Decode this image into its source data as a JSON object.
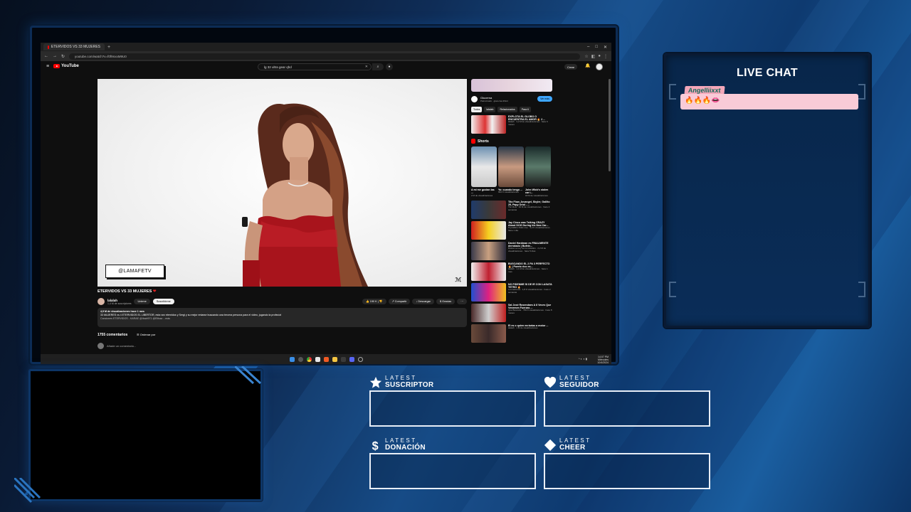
{
  "browser": {
    "tab_title": "ETERVIDOS VS 33 MUJERES",
    "new_tab": "+",
    "url": "youtube.com/watch?v=f0f9nxxM9U0",
    "window_controls": [
      "–",
      "□",
      "✕"
    ]
  },
  "youtube": {
    "logo_text": "YouTube",
    "search_query": "lg 32 ultra gear qhd",
    "create_label": "Crear",
    "video": {
      "title": "ETERVIDOS VS 33 MUJERES",
      "watermark": "@LAMAFETV",
      "channel_name": "lalalah",
      "channel_subs": "1,4 M de suscriptores",
      "join_label": "Unirme",
      "subscribe_label": "Suscribirme",
      "likes": "190 K",
      "share_label": "Compartir",
      "download_label": "Descargar",
      "thanks_label": "Gracias",
      "views_line": "4,9 M de visualizaciones  hace 1 mes",
      "desc_line": "33 MUJERES vs 4 ETERVIDOS EL LIBERTOR, esta vez eternidos y Sergi y su mejor entarse buscando una tercera persona para el video, jugando la profecía!",
      "chapters_line": "Canciones  ETERVIDOS - KARAE   @Ibairi971   @Elibaa   ...más",
      "comments_count": "1755 comentarios",
      "sort_label": "Ordenar por",
      "add_comment_placeholder": "Añade un comentario..."
    },
    "sidebar": {
      "ad_name": "Glucerna",
      "ad_sub": "Patrocinado · glucerna.cl/bmt",
      "ad_button": "Ver más",
      "chips": [
        "Todos",
        "lalalah",
        "Relacionados",
        "Para ti"
      ],
      "top_rec": {
        "title": "EXPLOTA EL GLOBO O ENCUENTRA EL AMOR 🔥 2 ...",
        "meta": "lalalah · 3,2 M de visualizaciones · hace 6 meses"
      },
      "shorts_label": "Shorts",
      "shorts": [
        {
          "title": "A mí me gustan las ...",
          "meta": "2 M de visualizaciones"
        },
        {
          "title": "Yo: cuando tengo ...",
          "meta": "994 K visualizaciones"
        },
        {
          "title": "John Wick's stolen car i...",
          "meta": "18 M de visualizaciones"
        }
      ],
      "recs": [
        {
          "title": "Tito Flow, Arcangel, Skyler, Gallito 29, Papy Oriol - ...",
          "meta": "Tito Flow · 46 M de visualizaciones · hace 2 semanas"
        },
        {
          "title": "Jay Cinco was Talking CRAZY About DOG During his New Car...",
          "meta": "Krystalline Rolls Live · 3,2 K visualizaciones · hace 1 día"
        },
        {
          "title": "Daniel Hardman es FINALMENTE derrotado | Bufete...",
          "meta": "Bufete La Ley de los Asfaltos · 2,2 M de visualizaciones · hace 5 días"
        },
        {
          "title": "BUSCANDO EL 2 PA 3 PERFECTO 🔥 | Puerto rico es...",
          "meta": "lalalah · 1,1 M de visualizaciones · hace 1 mes"
        },
        {
          "title": "NO PIDENME SI DE IR CON LASATA TETRO 🔥",
          "meta": "Los ladrones · 1,8 K visualizaciones · hace 2 semanas"
        },
        {
          "title": "Sal José Rosendaes A 8 Veces Que Venemen Fuerzas ...",
          "meta": "Que Buscarte · 799 K visualizaciones · hace 8 meses"
        },
        {
          "title": "El es o quien enriarias a motor ...",
          "meta": "lalalah · 1 M de visualizaciones"
        }
      ]
    },
    "taskbar": {
      "clock_time": "14:07 PM",
      "clock_day": "Miércoles",
      "clock_date": "10/4/2024",
      "tray": "^ ◐ ◖ ▮"
    }
  },
  "chat": {
    "title": "LIVE CHAT",
    "messages": [
      {
        "user": "Angelliixxt",
        "text": "🔥🔥🔥👄"
      }
    ]
  },
  "widgets": [
    {
      "top": "LATEST",
      "name": "SUSCRIPTOR",
      "icon": "star-icon"
    },
    {
      "top": "LATEST",
      "name": "SEGUIDOR",
      "icon": "heart-icon"
    },
    {
      "top": "LATEST",
      "name": "DONACIÓN",
      "icon": "dollar-icon"
    },
    {
      "top": "LATEST",
      "name": "CHEER",
      "icon": "diamond-icon"
    }
  ],
  "colors": {
    "accent_blue": "#164b86",
    "chat_user_bg": "#f3a7b9",
    "chat_msg_bg": "#f9cbd7",
    "youtube_red": "#ff0000"
  }
}
